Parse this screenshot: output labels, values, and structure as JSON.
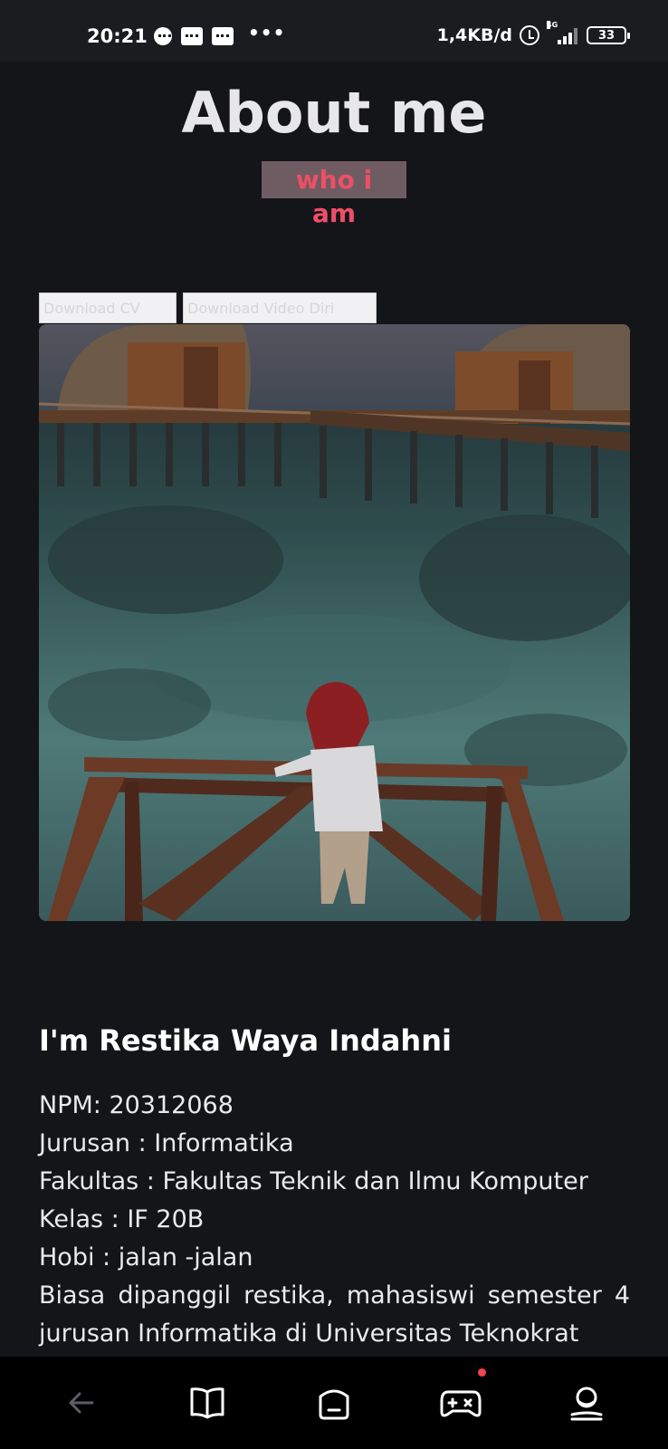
{
  "status_bar": {
    "time": "20:21",
    "network_speed": "1,4KB/d",
    "network_type": "4G",
    "battery": "33"
  },
  "header": {
    "title": "About me",
    "subtitle": "who i am"
  },
  "buttons": {
    "download_cv": "Download CV",
    "download_video": "Download Video Diri"
  },
  "profile": {
    "name": "I'm Restika Waya Indahni",
    "npm": "NPM: 20312068",
    "jurusan": "Jurusan : Informatika",
    "fakultas": "Fakultas : Fakultas Teknik dan Ilmu Komputer",
    "kelas": "Kelas : IF 20B",
    "hobi": "Hobi : jalan -jalan",
    "bio": "Biasa dipanggil restika, mahasiswi semester 4 jurusan Informatika di Universitas Teknokrat"
  },
  "nav": {
    "items": [
      "back-icon",
      "book-icon",
      "home-icon",
      "game-icon",
      "profile-icon"
    ],
    "accent": "#f1454f"
  },
  "colors": {
    "background": "#141519",
    "subtitle_text": "#ee4f67",
    "subtitle_bg": "#6f5c62"
  }
}
